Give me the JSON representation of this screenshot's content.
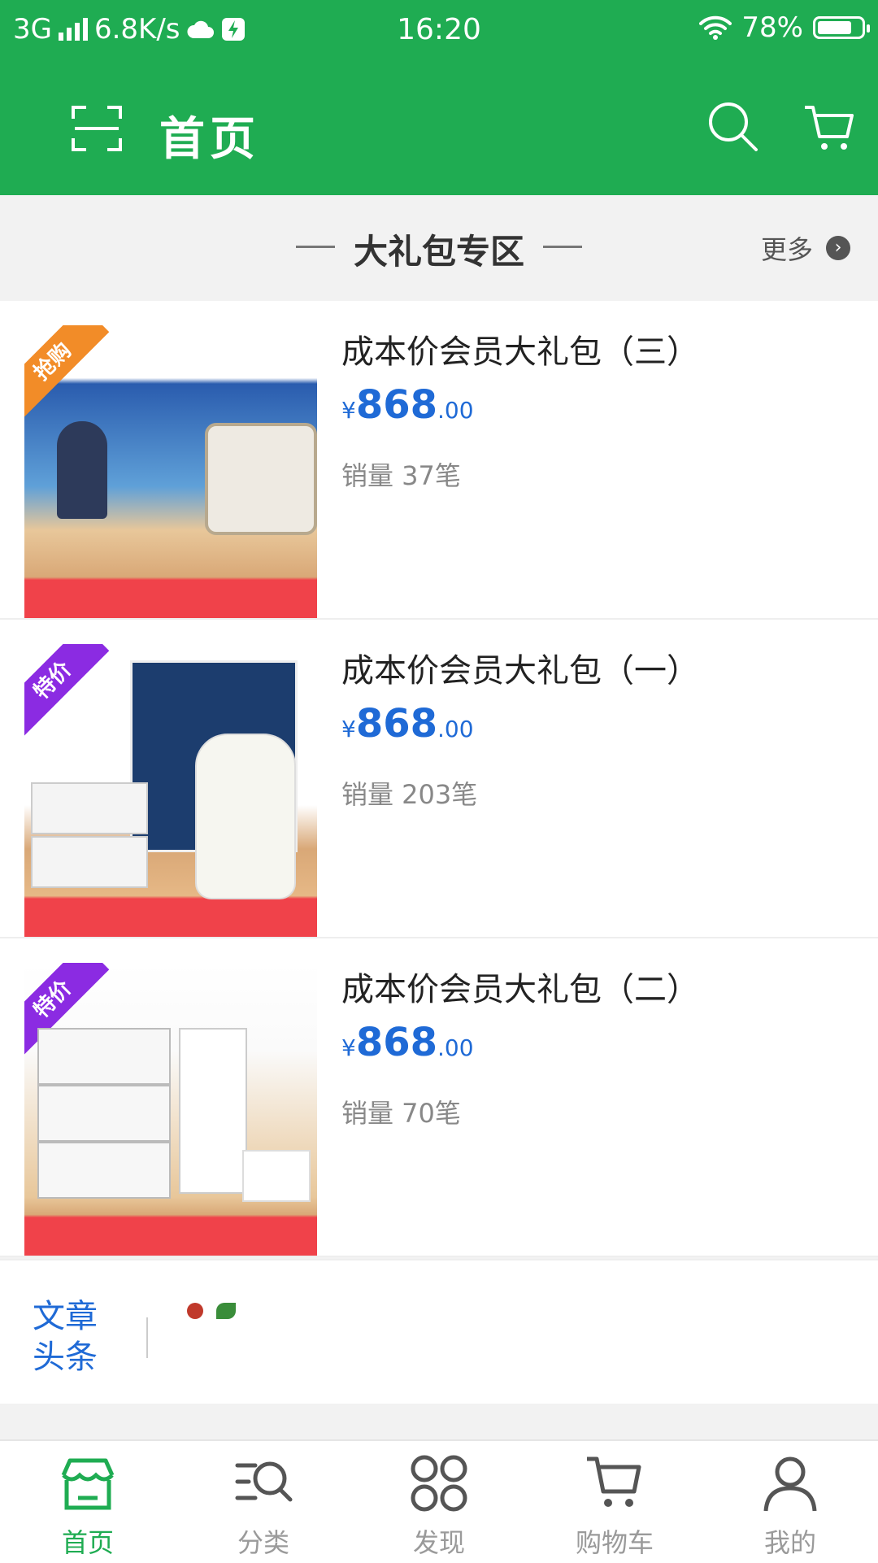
{
  "status_bar": {
    "network": "3G",
    "speed": "6.8K/s",
    "time": "16:20",
    "battery": "78%",
    "battery_level": 0.78
  },
  "header": {
    "title": "首页",
    "scan_icon": "scan-icon",
    "search_icon": "search-icon",
    "cart_icon": "cart-icon"
  },
  "section": {
    "title": "大礼包专区",
    "more_label": "更多"
  },
  "products": [
    {
      "name": "成本价会员大礼包（三）",
      "currency": "¥",
      "price_main": "868",
      "price_decimal": ".00",
      "sales": "销量 37笔",
      "badge": "抢购",
      "badge_color": "#f28c28"
    },
    {
      "name": "成本价会员大礼包（一）",
      "currency": "¥",
      "price_main": "868",
      "price_decimal": ".00",
      "sales": "销量 203笔",
      "badge": "特价",
      "badge_color": "#8b2be2"
    },
    {
      "name": "成本价会员大礼包（二）",
      "currency": "¥",
      "price_main": "868",
      "price_decimal": ".00",
      "sales": "销量 70笔",
      "badge": "特价",
      "badge_color": "#8b2be2"
    }
  ],
  "article": {
    "tag": "文章头条"
  },
  "tabbar": {
    "tabs": [
      {
        "label": "首页",
        "icon": "store-icon",
        "active": true
      },
      {
        "label": "分类",
        "icon": "category-search-icon",
        "active": false
      },
      {
        "label": "发现",
        "icon": "discover-grid-icon",
        "active": false
      },
      {
        "label": "购物车",
        "icon": "cart-icon",
        "active": false
      },
      {
        "label": "我的",
        "icon": "user-icon",
        "active": false
      }
    ]
  },
  "colors": {
    "brand_green": "#1fac52",
    "price_blue": "#1f6ad6"
  }
}
